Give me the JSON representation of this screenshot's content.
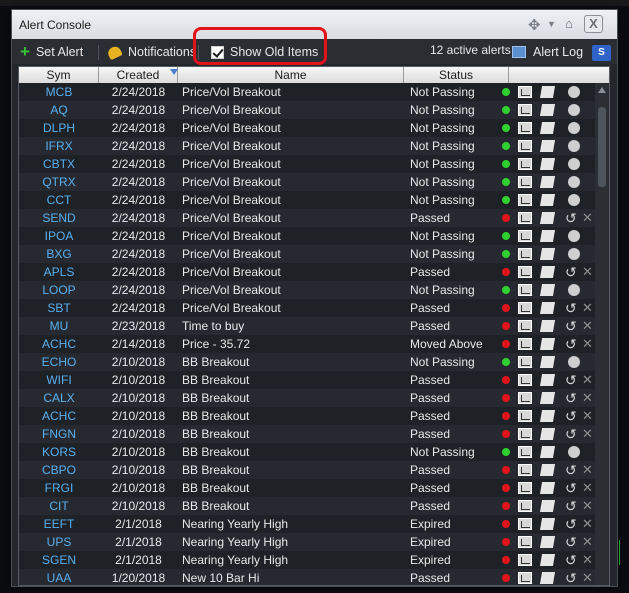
{
  "window": {
    "title": "Alert Console",
    "close_label": "X"
  },
  "toolbar": {
    "set_alert": "Set Alert",
    "notifications": "Notifications",
    "show_old_items": "Show Old Items",
    "show_old_items_checked": true,
    "active_count": "12 active alerts",
    "alert_log": "Alert Log",
    "s_button": "S"
  },
  "table": {
    "columns": [
      "Sym",
      "Created",
      "Name",
      "Status"
    ],
    "rows": [
      {
        "sym": "MCB",
        "created": "2/24/2018",
        "name": "Price/Vol Breakout",
        "status": "Not Passing",
        "dot": "green"
      },
      {
        "sym": "AQ",
        "created": "2/24/2018",
        "name": "Price/Vol Breakout",
        "status": "Not Passing",
        "dot": "green"
      },
      {
        "sym": "DLPH",
        "created": "2/24/2018",
        "name": "Price/Vol Breakout",
        "status": "Not Passing",
        "dot": "green"
      },
      {
        "sym": "IFRX",
        "created": "2/24/2018",
        "name": "Price/Vol Breakout",
        "status": "Not Passing",
        "dot": "green"
      },
      {
        "sym": "CBTX",
        "created": "2/24/2018",
        "name": "Price/Vol Breakout",
        "status": "Not Passing",
        "dot": "green"
      },
      {
        "sym": "QTRX",
        "created": "2/24/2018",
        "name": "Price/Vol Breakout",
        "status": "Not Passing",
        "dot": "green"
      },
      {
        "sym": "CCT",
        "created": "2/24/2018",
        "name": "Price/Vol Breakout",
        "status": "Not Passing",
        "dot": "green"
      },
      {
        "sym": "SEND",
        "created": "2/24/2018",
        "name": "Price/Vol Breakout",
        "status": "Passed",
        "dot": "red"
      },
      {
        "sym": "IPOA",
        "created": "2/24/2018",
        "name": "Price/Vol Breakout",
        "status": "Not Passing",
        "dot": "green"
      },
      {
        "sym": "BXG",
        "created": "2/24/2018",
        "name": "Price/Vol Breakout",
        "status": "Not Passing",
        "dot": "green"
      },
      {
        "sym": "APLS",
        "created": "2/24/2018",
        "name": "Price/Vol Breakout",
        "status": "Passed",
        "dot": "red"
      },
      {
        "sym": "LOOP",
        "created": "2/24/2018",
        "name": "Price/Vol Breakout",
        "status": "Not Passing",
        "dot": "green"
      },
      {
        "sym": "SBT",
        "created": "2/24/2018",
        "name": "Price/Vol Breakout",
        "status": "Passed",
        "dot": "red"
      },
      {
        "sym": "MU",
        "created": "2/23/2018",
        "name": "Time to buy",
        "status": "Passed",
        "dot": "red"
      },
      {
        "sym": "ACHC",
        "created": "2/14/2018",
        "name": "Price - 35.72",
        "status": "Moved Above",
        "dot": "red"
      },
      {
        "sym": "ECHO",
        "created": "2/10/2018",
        "name": "BB Breakout",
        "status": "Not Passing",
        "dot": "green"
      },
      {
        "sym": "WIFI",
        "created": "2/10/2018",
        "name": "BB Breakout",
        "status": "Passed",
        "dot": "red"
      },
      {
        "sym": "CALX",
        "created": "2/10/2018",
        "name": "BB Breakout",
        "status": "Passed",
        "dot": "red"
      },
      {
        "sym": "ACHC",
        "created": "2/10/2018",
        "name": "BB Breakout",
        "status": "Passed",
        "dot": "red"
      },
      {
        "sym": "FNGN",
        "created": "2/10/2018",
        "name": "BB Breakout",
        "status": "Passed",
        "dot": "red"
      },
      {
        "sym": "KORS",
        "created": "2/10/2018",
        "name": "BB Breakout",
        "status": "Not Passing",
        "dot": "green"
      },
      {
        "sym": "CBPO",
        "created": "2/10/2018",
        "name": "BB Breakout",
        "status": "Passed",
        "dot": "red"
      },
      {
        "sym": "FRGI",
        "created": "2/10/2018",
        "name": "BB Breakout",
        "status": "Passed",
        "dot": "red"
      },
      {
        "sym": "CIT",
        "created": "2/10/2018",
        "name": "BB Breakout",
        "status": "Passed",
        "dot": "red"
      },
      {
        "sym": "EEFT",
        "created": "2/1/2018",
        "name": "Nearing Yearly High",
        "status": "Expired",
        "dot": "red"
      },
      {
        "sym": "UPS",
        "created": "2/1/2018",
        "name": "Nearing Yearly High",
        "status": "Expired",
        "dot": "red"
      },
      {
        "sym": "SGEN",
        "created": "2/1/2018",
        "name": "Nearing Yearly High",
        "status": "Expired",
        "dot": "red"
      },
      {
        "sym": "UAA",
        "created": "1/20/2018",
        "name": "New 10 Bar Hi",
        "status": "Passed",
        "dot": "red"
      }
    ]
  },
  "colors": {
    "highlight": "#e1121a",
    "green_dot": "#2fd12f",
    "red_dot": "#e0151c",
    "symbol": "#5ab0f0"
  },
  "icons": [
    "plus-icon",
    "bell-icon",
    "move-icon",
    "pin-icon",
    "close-icon",
    "alert-log-icon",
    "chart-icon",
    "note-icon",
    "action-icon",
    "reset-icon",
    "delete-icon",
    "sort-arrow-icon"
  ]
}
